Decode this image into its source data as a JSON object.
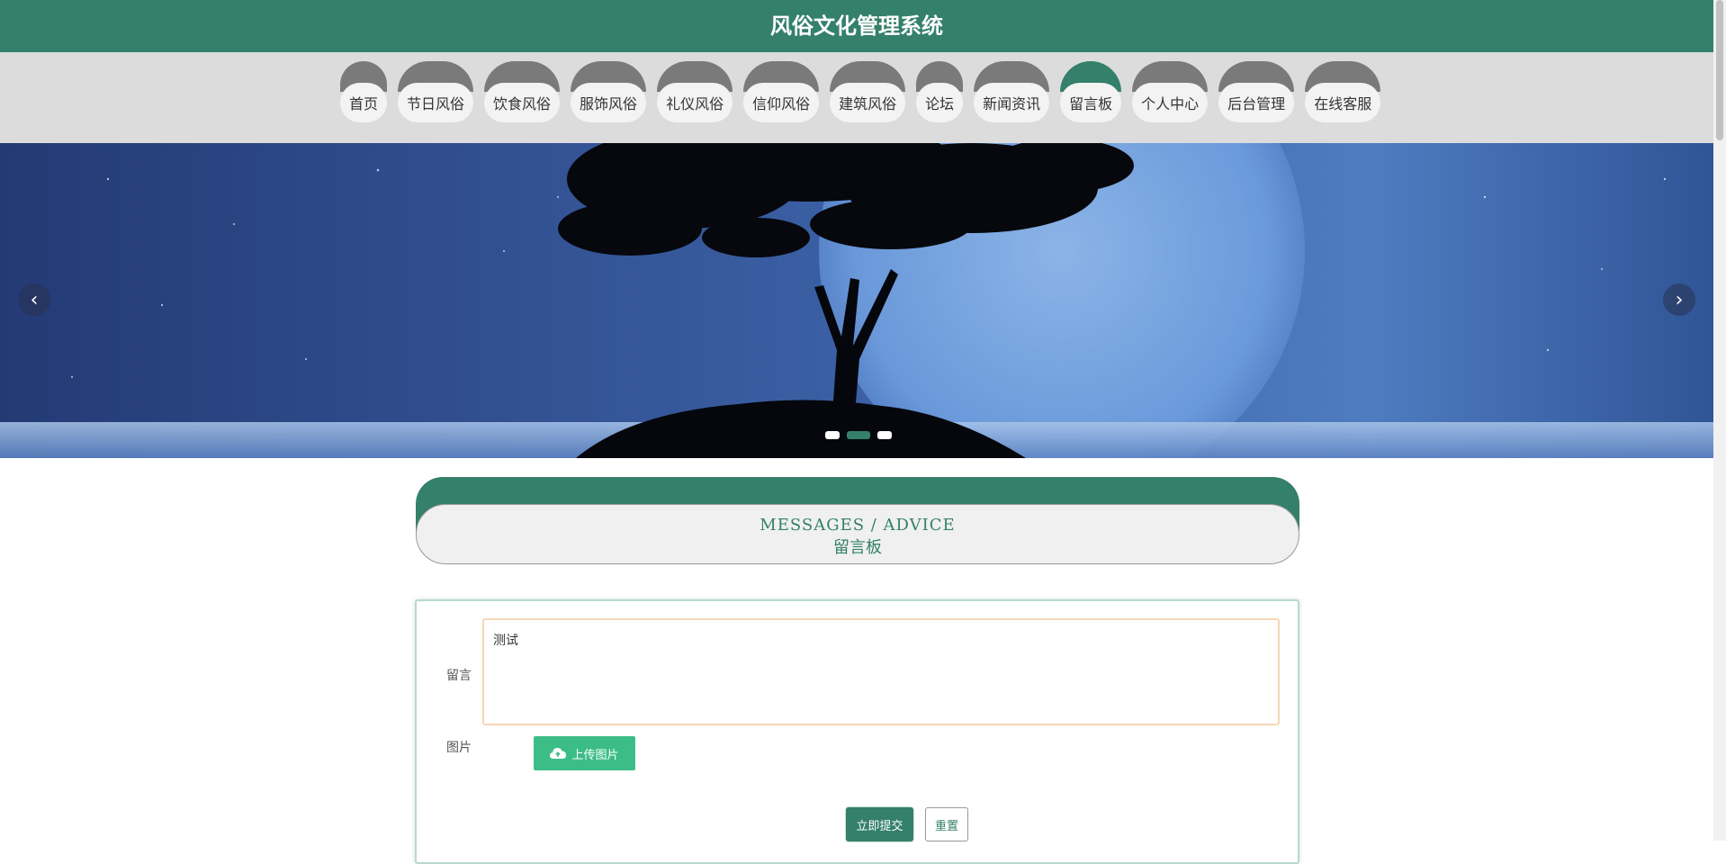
{
  "app": {
    "title": "风俗文化管理系统"
  },
  "nav": {
    "items": [
      {
        "label": "首页"
      },
      {
        "label": "节日风俗"
      },
      {
        "label": "饮食风俗"
      },
      {
        "label": "服饰风俗"
      },
      {
        "label": "礼仪风俗"
      },
      {
        "label": "信仰风俗"
      },
      {
        "label": "建筑风俗"
      },
      {
        "label": "论坛"
      },
      {
        "label": "新闻资讯"
      },
      {
        "label": "留言板"
      },
      {
        "label": "个人中心"
      },
      {
        "label": "后台管理"
      },
      {
        "label": "在线客服"
      }
    ],
    "active_index": 9
  },
  "banner": {
    "prev_icon": "chevron-left-icon",
    "next_icon": "chevron-right-icon",
    "slide_count": 3,
    "active_slide": 2
  },
  "section": {
    "title_en": "MESSAGES / ADVICE",
    "title_zh": "留言板"
  },
  "form": {
    "message_label": "留言",
    "message_value": "测试",
    "image_label": "图片",
    "upload_label": "上传图片",
    "upload_icon": "cloud-upload-icon",
    "submit_label": "立即提交",
    "reset_label": "重置"
  },
  "colors": {
    "primary": "#34806a",
    "upload": "#3cbd87",
    "nav_bg": "#dcdcdc",
    "tab_cap": "#7a7a7a"
  }
}
